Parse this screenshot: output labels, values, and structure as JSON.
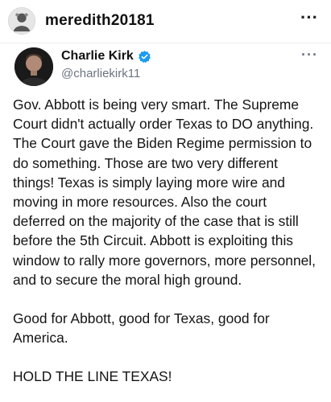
{
  "top_bar": {
    "username": "meredith20181",
    "more_label": "···",
    "avatar_icon": "profile-avatar-icon"
  },
  "tweet": {
    "display_name": "Charlie Kirk",
    "handle": "@charliekirk11",
    "verified": true,
    "verified_color": "#1d9bf0",
    "more_label": "···",
    "paragraphs": [
      "Gov. Abbott is being very smart. The Supreme Court didn't actually order Texas to DO anything. The Court gave the Biden Regime permission to do something. Those are two very different things! Texas is simply laying more wire and moving in more resources. Also the court deferred on the majority of the case that is still before the 5th Circuit. Abbott is exploiting this window to rally more governors, more personnel, and to secure the moral high ground.",
      "Good for Abbott, good for Texas, good for America.",
      "HOLD THE LINE TEXAS!"
    ]
  }
}
